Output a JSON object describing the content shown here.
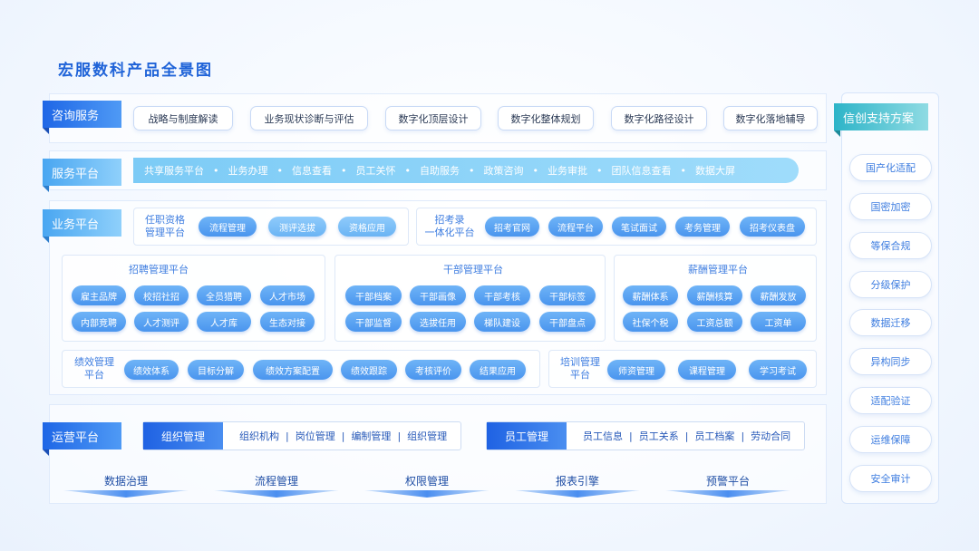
{
  "title": "宏服数科产品全景图",
  "consulting": {
    "label": "咨询服务",
    "items": [
      "战略与制度解读",
      "业务现状诊断与评估",
      "数字化顶层设计",
      "数字化整体规划",
      "数字化路径设计",
      "数字化落地辅导"
    ]
  },
  "service": {
    "label": "服务平台",
    "items": [
      "共享服务平台",
      "业务办理",
      "信息查看",
      "员工关怀",
      "自助服务",
      "政策咨询",
      "业务审批",
      "团队信息查看",
      "数据大屏"
    ]
  },
  "business": {
    "label": "业务平台",
    "tenure": {
      "label": "任职资格\n管理平台",
      "items": [
        "流程管理",
        "测评选拔",
        "资格应用"
      ]
    },
    "exam": {
      "label": "招考录\n一体化平台",
      "items": [
        "招考官网",
        "流程平台",
        "笔试面试",
        "考务管理",
        "招考仪表盘"
      ]
    },
    "recruit": {
      "title": "招聘管理平台",
      "items": [
        "雇主品牌",
        "校招社招",
        "全员猎聘",
        "人才市场",
        "内部竞聘",
        "人才测评",
        "人才库",
        "生态对接"
      ]
    },
    "cadre": {
      "title": "干部管理平台",
      "items": [
        "干部档案",
        "干部画像",
        "干部考核",
        "干部标签",
        "干部监督",
        "选拔任用",
        "梯队建设",
        "干部盘点"
      ]
    },
    "salary": {
      "title": "薪酬管理平台",
      "items": [
        "薪酬体系",
        "薪酬核算",
        "薪酬发放",
        "社保个税",
        "工资总额",
        "工资单"
      ]
    },
    "perf": {
      "label": "绩效管理\n平台",
      "items": [
        "绩效体系",
        "目标分解",
        "绩效方案配置",
        "绩效跟踪",
        "考核评价",
        "结果应用"
      ]
    },
    "training": {
      "label": "培训管理\n平台",
      "items": [
        "师资管理",
        "课程管理",
        "学习考试"
      ]
    }
  },
  "ops": {
    "label": "运营平台",
    "org": {
      "head": "组织管理",
      "items": [
        "组织机构",
        "岗位管理",
        "编制管理",
        "组织管理"
      ]
    },
    "emp": {
      "head": "员工管理",
      "items": [
        "员工信息",
        "员工关系",
        "员工档案",
        "劳动合同"
      ]
    },
    "bottom": [
      "数据治理",
      "流程管理",
      "权限管理",
      "报表引擎",
      "预警平台"
    ]
  },
  "xinchuang": {
    "label": "信创支持方案",
    "items": [
      "国产化适配",
      "国密加密",
      "等保合规",
      "分级保护",
      "数据迁移",
      "异构同步",
      "适配验证",
      "运维保障",
      "安全审计"
    ]
  }
}
